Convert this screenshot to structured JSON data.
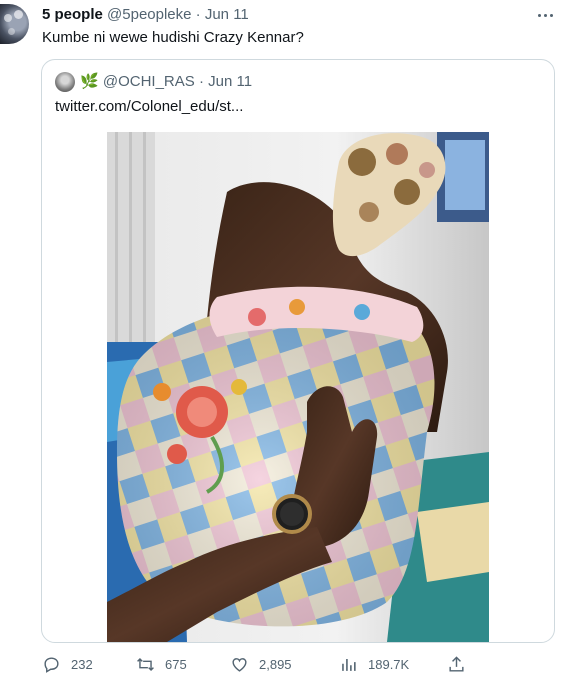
{
  "tweet": {
    "author_name": "5 people",
    "author_handle": "@5peopleke",
    "separator": "·",
    "date": "Jun 11",
    "text": "Kumbe ni wewe hudishi Crazy Kennar?",
    "more_icon": "more-horizontal-icon"
  },
  "quote": {
    "author_handle": "@OCHI_RAS",
    "leaf_glyph": "🌿",
    "separator": "·",
    "date": "Jun 11",
    "text": "twitter.com/Colonel_edu/st..."
  },
  "actions": {
    "reply_count": "232",
    "retweet_count": "675",
    "like_count": "2,895",
    "views_count": "189.7K",
    "icons": [
      "reply-icon",
      "retweet-icon",
      "like-icon",
      "views-icon",
      "share-icon"
    ]
  },
  "colors": {
    "text_primary": "#0f1419",
    "text_secondary": "#536471",
    "border": "#cfd9de"
  }
}
